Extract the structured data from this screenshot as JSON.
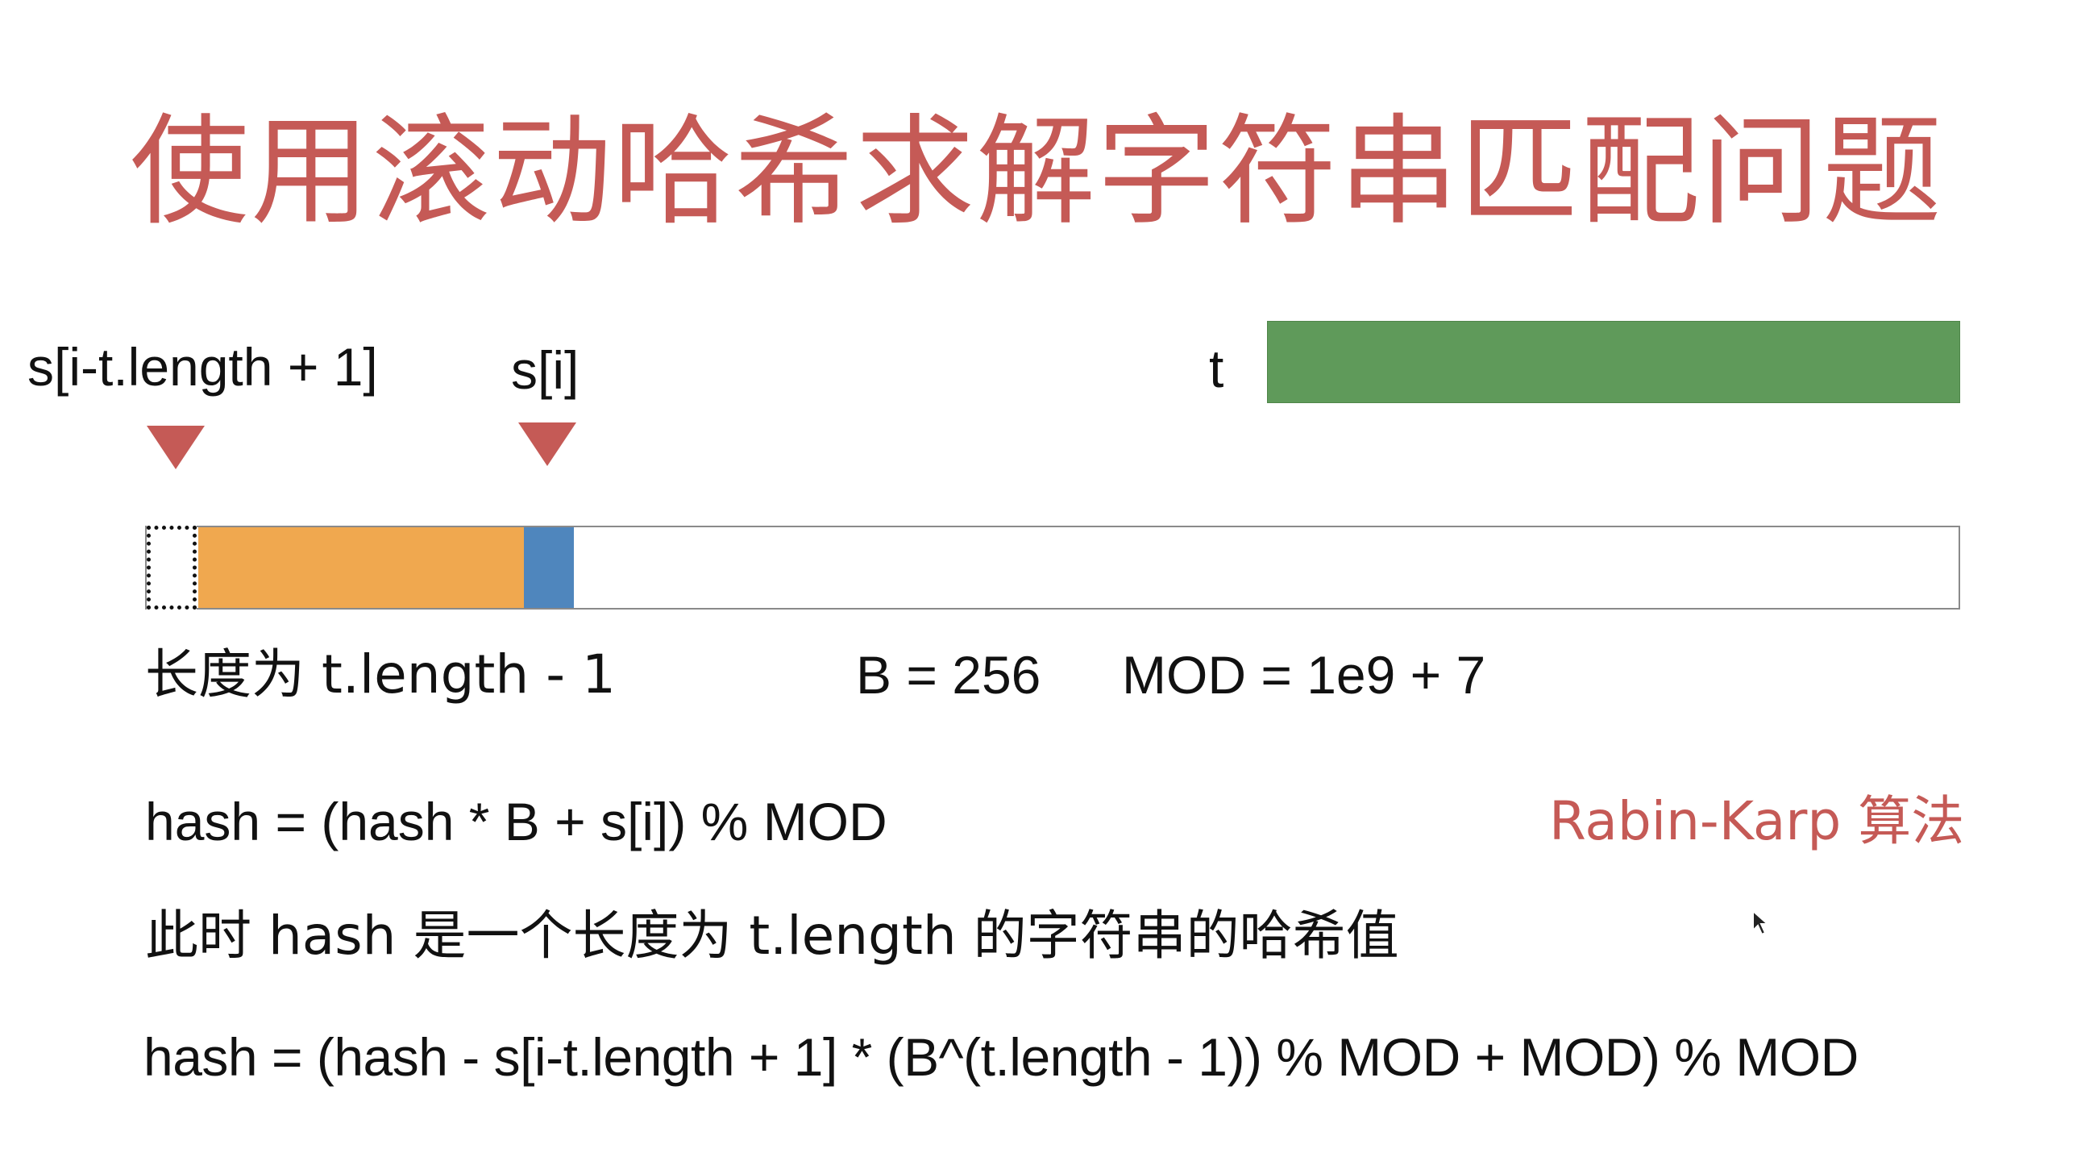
{
  "slide": {
    "title": "使用滚动哈希求解字符串匹配问题"
  },
  "diagram": {
    "left_pointer_label": "s[i-t.length + 1]",
    "right_pointer_label": "s[i]",
    "pattern_label": "t",
    "window_caption": "长度为 t.length - 1",
    "base_text": "B = 256",
    "mod_text": "MOD = 1e9 + 7",
    "colors": {
      "title": "#c55a56",
      "pointer": "#c55a56",
      "pattern_bar": "#5f9a5a",
      "window_segment": "#f0a84f",
      "new_char_segment": "#4f86bd"
    }
  },
  "formulas": {
    "hash_update": "hash = (hash * B + s[i]) % MOD",
    "algorithm_name": "Rabin-Karp 算法",
    "explanation": "此时 hash 是一个长度为 t.length 的字符串的哈希值",
    "hash_remove": "hash = (hash - s[i-t.length + 1] * (B^(t.length - 1)) % MOD + MOD) % MOD"
  },
  "icons": {
    "cursor": "mouse-pointer-icon"
  }
}
